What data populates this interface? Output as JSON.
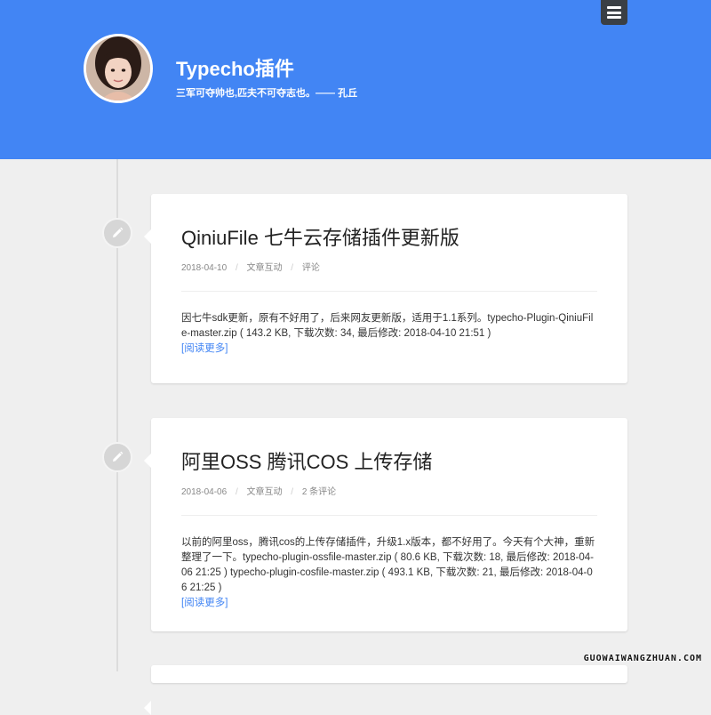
{
  "site": {
    "title": "Typecho插件",
    "description": "三军可夺帅也,匹夫不可夺志也。—— 孔丘"
  },
  "menu": {
    "icon": "hamburger-menu-icon"
  },
  "posts": [
    {
      "title": "QiniuFile 七牛云存储插件更新版",
      "date": "2018-04-10",
      "category": "文章互动",
      "comments": "评论",
      "excerpt": "因七牛sdk更新，原有不好用了，后来网友更新版，适用于1.1系列。typecho-Plugin-QiniuFile-master.zip ( 143.2 KB, 下载次数: 34, 最后修改: 2018-04-10 21:51 )",
      "more": "[阅读更多]"
    },
    {
      "title": "阿里OSS 腾讯COS 上传存储",
      "date": "2018-04-06",
      "category": "文章互动",
      "comments": "2 条评论",
      "excerpt": "以前的阿里oss，腾讯cos的上传存储插件，升级1.x版本，都不好用了。今天有个大神，重新整理了一下。typecho-plugin-ossfile-master.zip ( 80.6 KB, 下载次数: 18, 最后修改: 2018-04-06 21:25 ) typecho-plugin-cosfile-master.zip ( 493.1 KB, 下载次数: 21, 最后修改: 2018-04-06 21:25 )",
      "more": "[阅读更多]"
    }
  ],
  "icons": {
    "post": "pencil-icon"
  },
  "colors": {
    "header": "#4285f4",
    "link": "#4285f4"
  },
  "watermark": "GUOWAIWANGZHUAN.COM"
}
